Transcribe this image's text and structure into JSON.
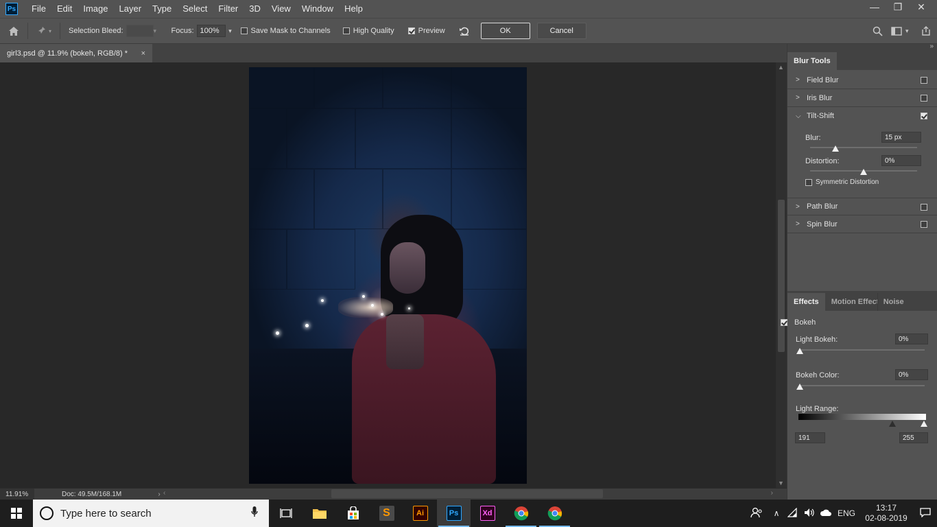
{
  "app": {
    "logo": "Ps"
  },
  "menu": [
    "File",
    "Edit",
    "Image",
    "Layer",
    "Type",
    "Select",
    "Filter",
    "3D",
    "View",
    "Window",
    "Help"
  ],
  "window_controls": {
    "minimize": "—",
    "restore": "❐",
    "close": "✕"
  },
  "options": {
    "selection_bleed_label": "Selection Bleed:",
    "selection_bleed_value": "",
    "focus_label": "Focus:",
    "focus_value": "100%",
    "save_mask_label": "Save Mask to Channels",
    "save_mask_checked": false,
    "high_quality_label": "High Quality",
    "high_quality_checked": false,
    "preview_label": "Preview",
    "preview_checked": true,
    "ok_label": "OK",
    "cancel_label": "Cancel"
  },
  "document": {
    "tab_title": "girl3.psd @ 11.9% (bokeh, RGB/8) *",
    "close": "×"
  },
  "status": {
    "zoom": "11.91%",
    "doc": "Doc: 49.5M/168.1M"
  },
  "blur_tools": {
    "tab_label": "Blur Tools",
    "items": [
      {
        "label": "Field Blur",
        "checked": false
      },
      {
        "label": "Iris Blur",
        "checked": false
      },
      {
        "label": "Tilt-Shift",
        "checked": true
      },
      {
        "label": "Path Blur",
        "checked": false
      },
      {
        "label": "Spin Blur",
        "checked": false
      }
    ],
    "tilt_shift": {
      "blur_label": "Blur:",
      "blur_value": "15 px",
      "distortion_label": "Distortion:",
      "distortion_value": "0%",
      "symmetric_label": "Symmetric Distortion",
      "symmetric_checked": false
    }
  },
  "effects": {
    "tabs": [
      "Effects",
      "Motion Effects",
      "Noise"
    ],
    "bokeh_label": "Bokeh",
    "bokeh_checked": true,
    "light_bokeh_label": "Light Bokeh:",
    "light_bokeh_value": "0%",
    "bokeh_color_label": "Bokeh Color:",
    "bokeh_color_value": "0%",
    "light_range_label": "Light Range:",
    "light_range_low": "191",
    "light_range_high": "255"
  },
  "taskbar": {
    "search_placeholder": "Type here to search",
    "apps": [
      {
        "name": "task-view"
      },
      {
        "name": "file-explorer"
      },
      {
        "name": "store"
      },
      {
        "name": "sublime-text"
      },
      {
        "name": "illustrator",
        "label": "Ai"
      },
      {
        "name": "photoshop",
        "label": "Ps"
      },
      {
        "name": "xd",
        "label": "Xd"
      },
      {
        "name": "chrome"
      },
      {
        "name": "chrome-2"
      }
    ],
    "language": "ENG",
    "time": "13:17",
    "date": "02-08-2019"
  },
  "colors": {
    "accent": "#31a8ff",
    "panel": "#535353",
    "canvas": "#282828"
  }
}
